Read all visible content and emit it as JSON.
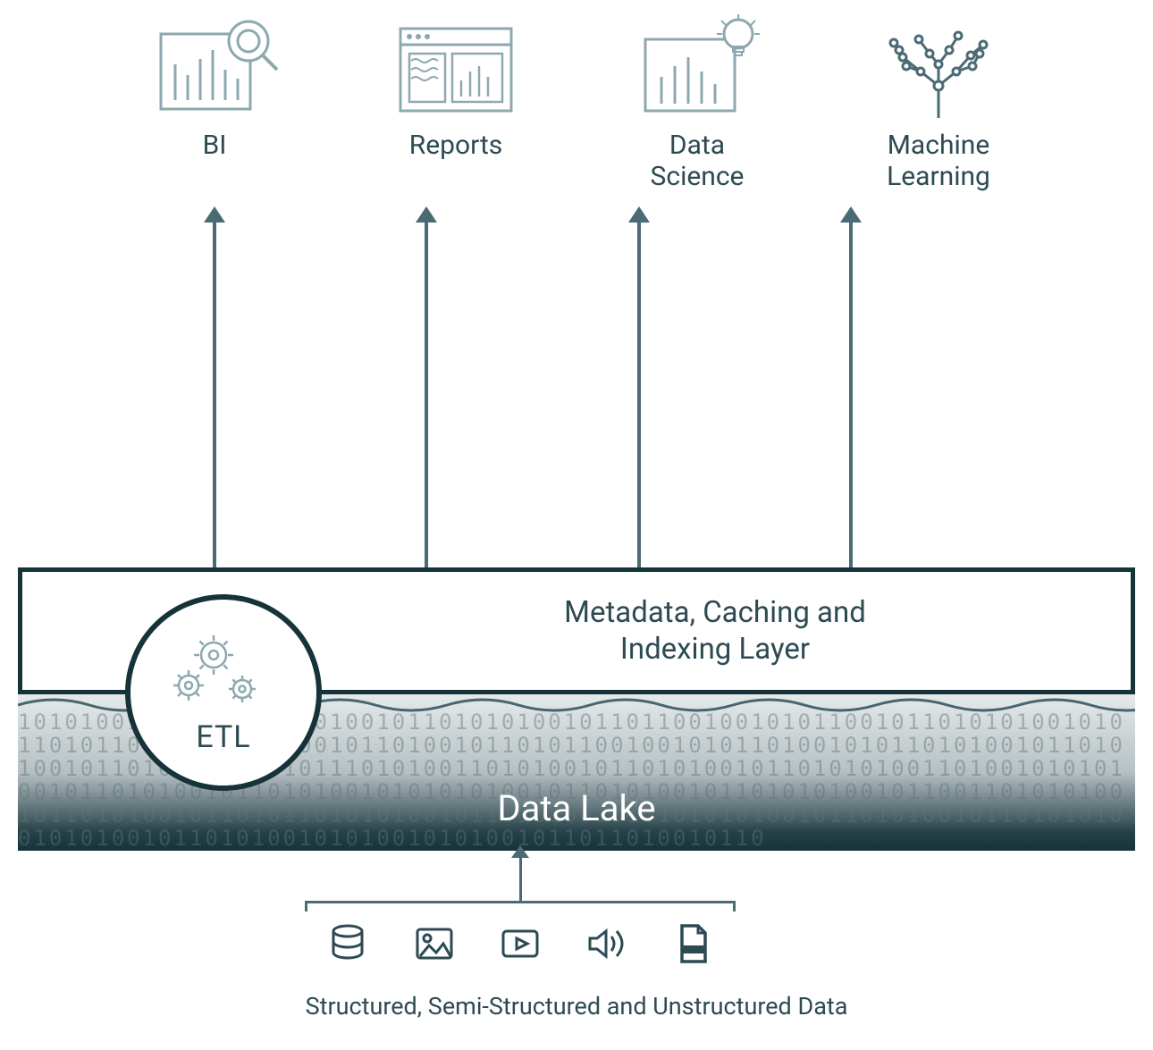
{
  "colors": {
    "dark": "#16333a",
    "mid": "#4a6b74",
    "light_stroke": "#8ea8af"
  },
  "consumers": [
    {
      "label": "BI",
      "icon": "bi-chart-magnifier-icon"
    },
    {
      "label": "Reports",
      "icon": "report-window-icon"
    },
    {
      "label": "Data\nScience",
      "icon": "chart-lightbulb-icon"
    },
    {
      "label": "Machine\nLearning",
      "icon": "circuit-tree-icon"
    }
  ],
  "middle_layer": {
    "label": "Metadata, Caching and\nIndexing Layer"
  },
  "etl": {
    "label": "ETL",
    "icon": "gears-icon"
  },
  "lake": {
    "label": "Data Lake",
    "binary_pattern": "1010100101101001011010010110101010010110110010010101100101101010100101011010110010010110100101101001011010110010010101101001010110101001011010100101101010100101011101010011010100101101010010110101010011010010101010010110101001011010100101010101001011010100101101010100101100110101010010110101001011010110101010010110101001010101010100101101010010110101010010101001011010100101010010101001011011010010110"
  },
  "sources": {
    "icons": [
      {
        "name": "database-icon"
      },
      {
        "name": "image-icon"
      },
      {
        "name": "video-icon"
      },
      {
        "name": "audio-icon"
      },
      {
        "name": "document-icon"
      }
    ],
    "caption": "Structured, Semi-Structured and Unstructured Data"
  }
}
